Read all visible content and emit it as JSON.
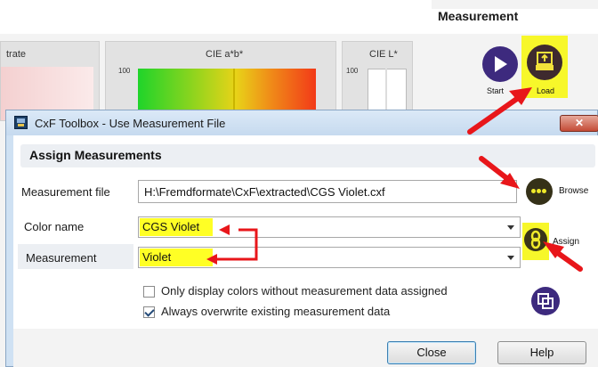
{
  "background_app": {
    "measurement_heading": "Measurement",
    "panels": [
      {
        "title": "trate",
        "axis_max": ""
      },
      {
        "title": "CIE a*b*",
        "axis_max": "100"
      },
      {
        "title": "CIE L*",
        "axis_max": "100"
      }
    ],
    "buttons": {
      "start": "Start",
      "load": "Load"
    }
  },
  "dialog": {
    "title": "CxF Toolbox - Use Measurement File",
    "close_glyph": "✕",
    "section_heading": "Assign Measurements",
    "fields": {
      "measurement_file": {
        "label": "Measurement file",
        "value": "H:\\Fremdformate\\CxF\\extracted\\CGS Violet.cxf"
      },
      "color_name": {
        "label": "Color name",
        "value": "CGS Violet"
      },
      "measurement": {
        "label": "Measurement",
        "value": "Violet"
      }
    },
    "side_buttons": {
      "browse": "Browse",
      "assign": "Assign"
    },
    "checkboxes": [
      {
        "label": "Only display colors without measurement data assigned",
        "checked": false
      },
      {
        "label": "Always overwrite existing measurement data",
        "checked": true
      }
    ],
    "footer": {
      "close": "Close",
      "help": "Help"
    }
  },
  "colors": {
    "highlight": "#ffff25",
    "annotation_red": "#e8161a",
    "accent_purple": "#3d2a7e"
  },
  "icons": [
    "play-icon",
    "load-tray-icon",
    "app-icon",
    "close-icon",
    "more-dots-icon",
    "chain-link-icon",
    "copy-icon",
    "checkmark-icon",
    "dropdown-arrow-icon"
  ]
}
